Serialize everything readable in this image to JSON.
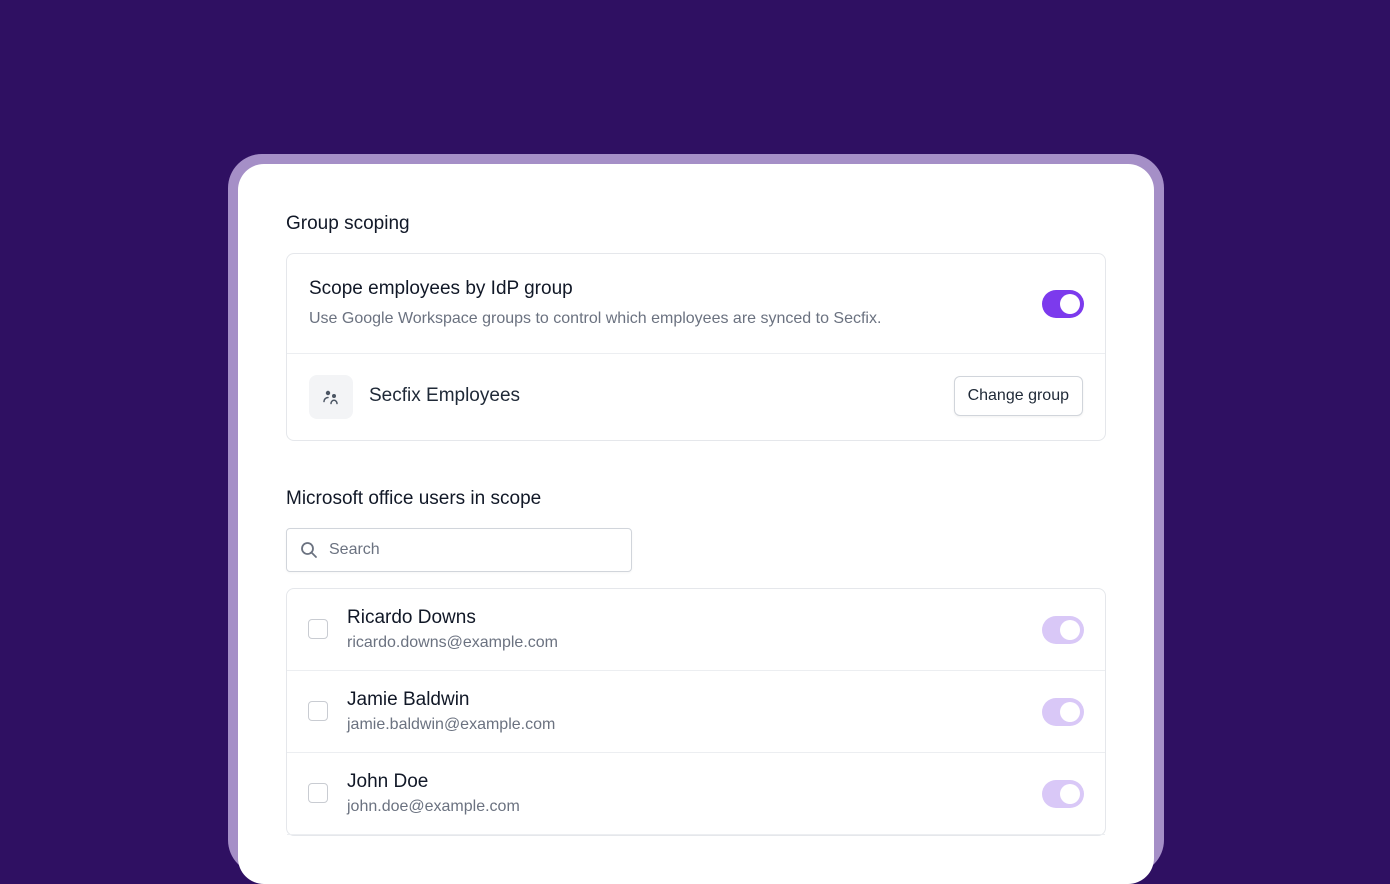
{
  "group_scoping": {
    "title": "Group scoping",
    "setting_title": "Scope employees by IdP group",
    "setting_description": "Use Google Workspace groups to control which employees are synced to Secfix.",
    "toggle_on": true,
    "group_name": "Secfix Employees",
    "group_icon": "users-icon",
    "change_button": "Change group"
  },
  "users_section": {
    "title": "Microsoft office users in scope",
    "search_placeholder": "Search",
    "search_icon": "search-icon",
    "users": [
      {
        "name": "Ricardo Downs",
        "email": "ricardo.downs@example.com",
        "enabled": true
      },
      {
        "name": "Jamie Baldwin",
        "email": "jamie.baldwin@example.com",
        "enabled": true
      },
      {
        "name": "John Doe",
        "email": "john.doe@example.com",
        "enabled": true
      }
    ]
  },
  "colors": {
    "background": "#2f1062",
    "frame": "#a58fc7",
    "accent": "#7c3aed",
    "accent_muted": "#d9c8f7"
  }
}
